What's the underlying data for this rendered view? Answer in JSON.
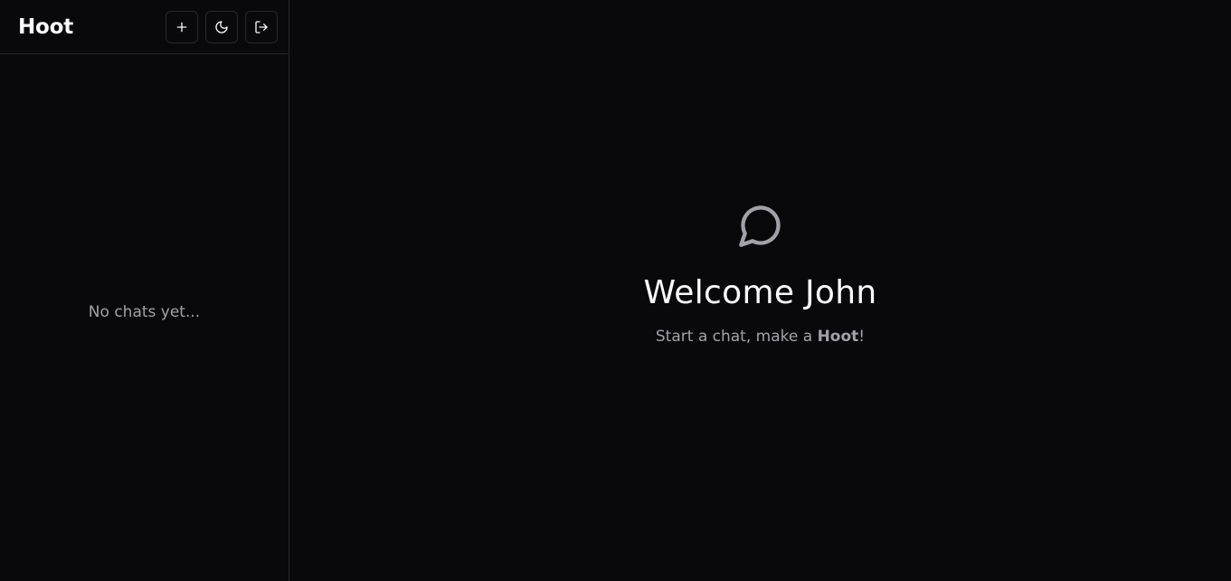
{
  "app": {
    "brand": "Hoot"
  },
  "sidebar": {
    "actions": [
      {
        "name": "new-chat",
        "icon": "plus-icon"
      },
      {
        "name": "theme-toggle",
        "icon": "moon-icon"
      },
      {
        "name": "logout",
        "icon": "log-out-icon"
      }
    ],
    "empty_text": "No chats yet..."
  },
  "main": {
    "icon": "message-circle-icon",
    "welcome_title": "Welcome John",
    "subtitle_prefix": "Start a chat, make a ",
    "subtitle_brand": "Hoot",
    "subtitle_suffix": "!"
  },
  "colors": {
    "background": "#09090b",
    "border": "#27272a",
    "text": "#fafafa",
    "muted": "#a1a1aa"
  }
}
